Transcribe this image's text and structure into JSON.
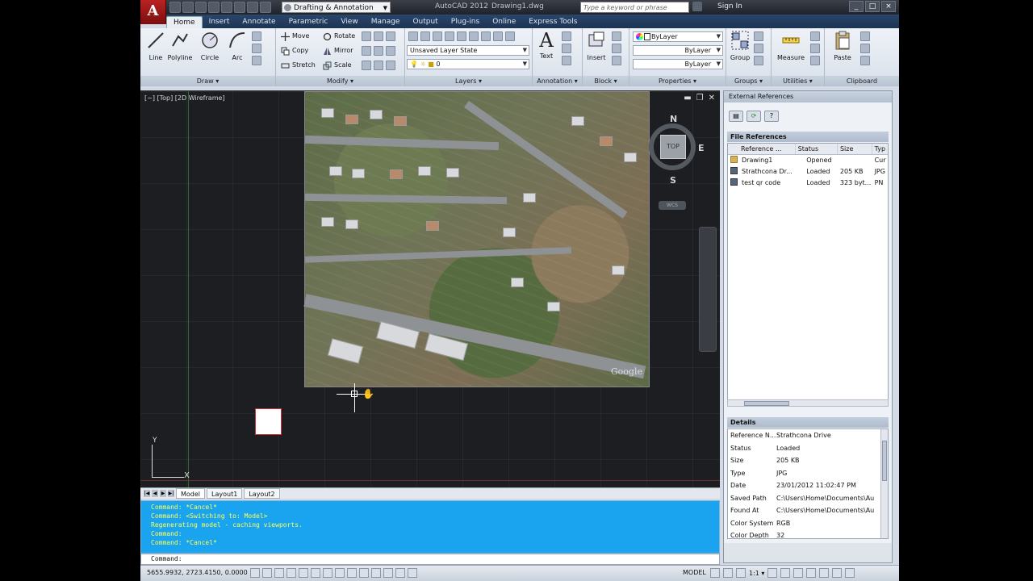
{
  "titlebar": {
    "app_letter": "A",
    "workspace": "Drafting & Annotation",
    "app_title": "AutoCAD 2012",
    "file_name": "Drawing1.dwg",
    "search_placeholder": "Type a keyword or phrase",
    "sign_in": "Sign In",
    "win_min": "_",
    "win_max": "□",
    "win_close": "×"
  },
  "ribbon_tabs": [
    "Home",
    "Insert",
    "Annotate",
    "Parametric",
    "View",
    "Manage",
    "Output",
    "Plug-ins",
    "Online",
    "Express Tools"
  ],
  "ribbon": {
    "draw": {
      "title": "Draw ▾",
      "line": "Line",
      "polyline": "Polyline",
      "circle": "Circle",
      "arc": "Arc"
    },
    "modify": {
      "title": "Modify ▾",
      "move": "Move",
      "rotate": "Rotate",
      "copy": "Copy",
      "mirror": "Mirror",
      "stretch": "Stretch",
      "scale": "Scale"
    },
    "layers": {
      "title": "Layers ▾",
      "layer_state": "Unsaved Layer State",
      "current_layer": "0"
    },
    "annotation": {
      "title": "Annotation ▾",
      "text": "Text"
    },
    "block": {
      "title": "Block ▾",
      "insert": "Insert"
    },
    "properties": {
      "title": "Properties ▾",
      "color": "ByLayer",
      "linetype": "ByLayer",
      "lineweight": "ByLayer"
    },
    "groups": {
      "title": "Groups ▾",
      "group": "Group"
    },
    "utilities": {
      "title": "Utilities ▾",
      "measure": "Measure"
    },
    "clipboard": {
      "title": "Clipboard",
      "paste": "Paste"
    }
  },
  "viewport": {
    "label": "[−] [Top] [2D Wireframe]",
    "ctl_min": "▬",
    "ctl_restore": "❐",
    "ctl_close": "✕",
    "aerial_watermark": "Google",
    "compass": {
      "n": "N",
      "e": "E",
      "s": "S",
      "top": "TOP"
    },
    "wcs": "WCS",
    "ucs_x": "X",
    "ucs_y": "Y"
  },
  "layout_tabs": [
    "Model",
    "Layout1",
    "Layout2"
  ],
  "command_history": [
    "Command: *Cancel*",
    "Command:   <Switching to: Model>",
    "Regenerating model - caching viewports.",
    "Command:",
    "Command: *Cancel*"
  ],
  "command_prompt": "Command:",
  "statusbar": {
    "coords": "5655.9932, 2723.4150, 0.0000",
    "model": "MODEL",
    "scale": "1:1 ▾"
  },
  "xref": {
    "title": "External References",
    "file_refs_title": "File References",
    "columns": [
      "Reference ...",
      "Status",
      "Size",
      "Typ"
    ],
    "rows": [
      {
        "name": "Drawing1",
        "status": "Opened",
        "size": "",
        "type": "Cur",
        "icon": "drawing-icon"
      },
      {
        "name": "Strathcona Dr...",
        "status": "Loaded",
        "size": "205 KB",
        "type": "JPG",
        "icon": "image-icon"
      },
      {
        "name": "test qr code",
        "status": "Loaded",
        "size": "323 byt...",
        "type": "PN",
        "icon": "image-icon"
      }
    ],
    "details_title": "Details",
    "details": [
      {
        "k": "Reference N...",
        "v": "Strathcona Drive"
      },
      {
        "k": "Status",
        "v": "Loaded"
      },
      {
        "k": "Size",
        "v": "205 KB"
      },
      {
        "k": "Type",
        "v": "JPG"
      },
      {
        "k": "Date",
        "v": "23/01/2012 11:02:47 PM"
      },
      {
        "k": "Saved Path",
        "v": "C:\\Users\\Home\\Documents\\Au"
      },
      {
        "k": "Found At",
        "v": "C:\\Users\\Home\\Documents\\Au"
      },
      {
        "k": "Color System",
        "v": "RGB"
      },
      {
        "k": "Color Depth",
        "v": "32"
      }
    ]
  }
}
